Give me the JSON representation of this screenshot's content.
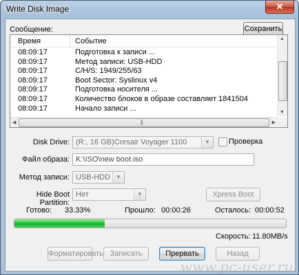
{
  "window": {
    "title": "Write Disk Image",
    "close_glyph": "✕"
  },
  "log": {
    "label": "Сообщение:",
    "save_button": "Сохранить",
    "columns": {
      "time": "Время",
      "event": "Событие"
    },
    "rows": [
      {
        "time": "08:09:17",
        "event": "Подготовка к записи ..."
      },
      {
        "time": "08:09:17",
        "event": "Метод записи: USB-HDD"
      },
      {
        "time": "08:09:17",
        "event": "C/H/S: 1949/255/63"
      },
      {
        "time": "08:09:17",
        "event": "Boot Sector: Syslinux v4"
      },
      {
        "time": "08:09:17",
        "event": "Подготовка носителя ..."
      },
      {
        "time": "08:09:17",
        "event": "Количество блоков в образе составляет 1841504"
      },
      {
        "time": "08:09:17",
        "event": "Начало записи ..."
      }
    ]
  },
  "form": {
    "disk_drive": {
      "label": "Disk Drive:",
      "value": "(R:, 16 GB)Corsair Voyager      1100"
    },
    "verify": {
      "label": "Проверка",
      "checked": false
    },
    "image_file": {
      "label": "Файл образа:",
      "value": "K:\\ISO\\new boot.iso"
    },
    "write_method": {
      "label": "Метод записи:",
      "value": "USB-HDD"
    },
    "hide_boot": {
      "label": "Hide Boot Partition:",
      "value": "Нет"
    },
    "xpress_boot": "Xpress Boot"
  },
  "status": {
    "done_label": "Готово:",
    "done_value": "33.33%",
    "elapsed_label": "Прошло:",
    "elapsed_value": "00:00:26",
    "remaining_label": "Осталось:",
    "remaining_value": "00:00:52",
    "speed_label": "Скорость:",
    "speed_value": "11.80MB/s",
    "progress_fraction": 0.3333
  },
  "buttons": {
    "format": "Форматировать",
    "write": "Записать",
    "abort": "Прервать",
    "back": "Назад"
  },
  "watermark": "www.pc-user.ru",
  "colors": {
    "progress": "#22c53a",
    "close": "#c75a45"
  }
}
